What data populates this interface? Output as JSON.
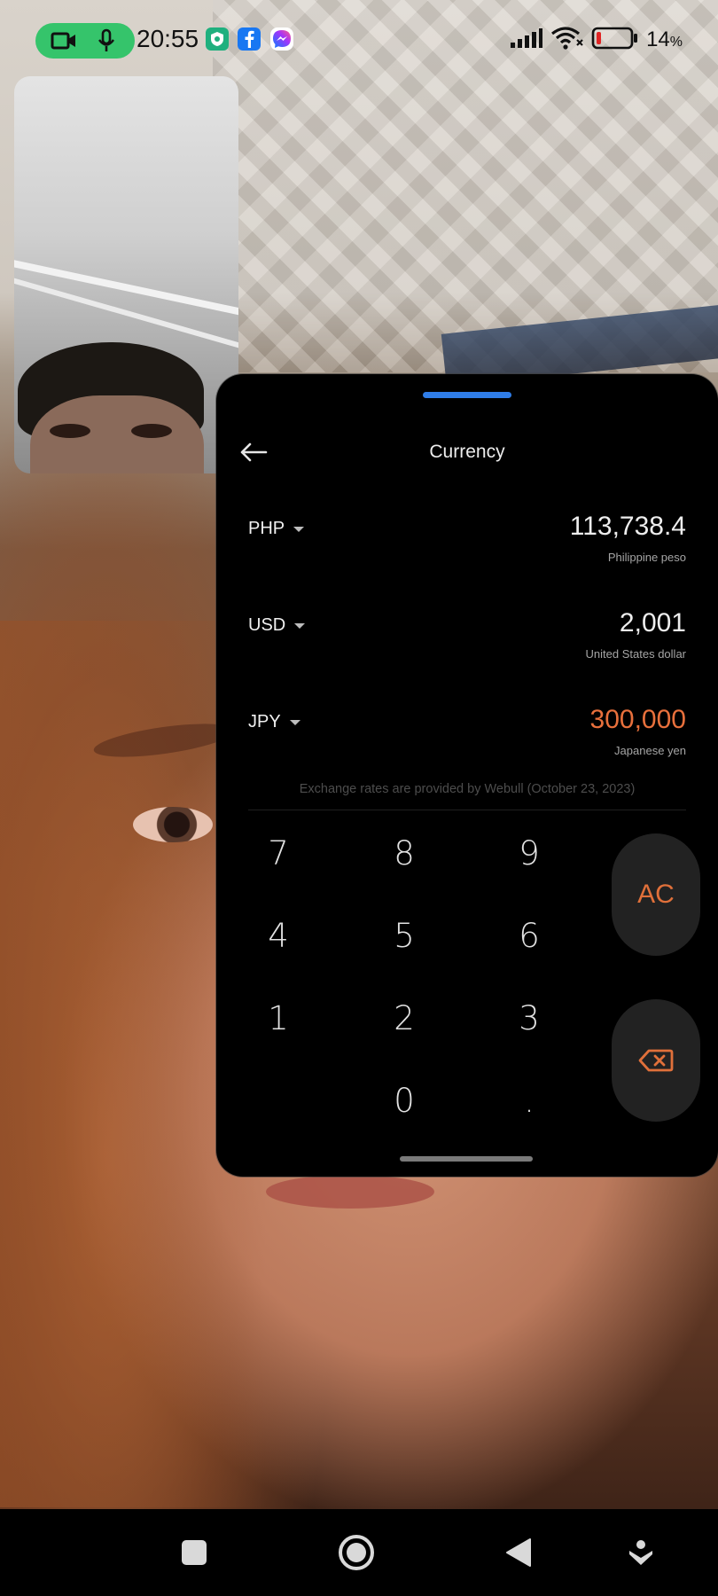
{
  "status_bar": {
    "time": "20:55",
    "battery_percent": "14",
    "battery_suffix": "%",
    "battery_level": 0.14,
    "call_color": "#35c46b",
    "battery_color": "#e02424",
    "icons": [
      "video-camera-icon",
      "microphone-icon",
      "shield-app-icon",
      "facebook-icon",
      "messenger-icon",
      "signal-icon",
      "wifi-icon",
      "battery-icon"
    ]
  },
  "currency_window": {
    "title": "Currency",
    "rows": [
      {
        "code": "PHP",
        "value": "113,738.4",
        "name": "Philippine peso",
        "active": false
      },
      {
        "code": "USD",
        "value": "2,001",
        "name": "United States dollar",
        "active": false
      },
      {
        "code": "JPY",
        "value": "300,000",
        "name": "Japanese yen",
        "active": true
      }
    ],
    "rates_note": "Exchange rates are provided by Webull (October 23, 2023)",
    "keypad": {
      "keys": [
        "7",
        "8",
        "9",
        "4",
        "5",
        "6",
        "1",
        "2",
        "3",
        "0",
        "."
      ],
      "clear_label": "AC",
      "backspace_icon": "backspace-icon"
    },
    "accent_color": "#e8703c",
    "handle_color": "#2f7de8"
  },
  "nav_bar": {
    "icons": [
      "recents-square-icon",
      "home-circle-icon",
      "back-triangle-icon",
      "assistant-icon"
    ]
  }
}
